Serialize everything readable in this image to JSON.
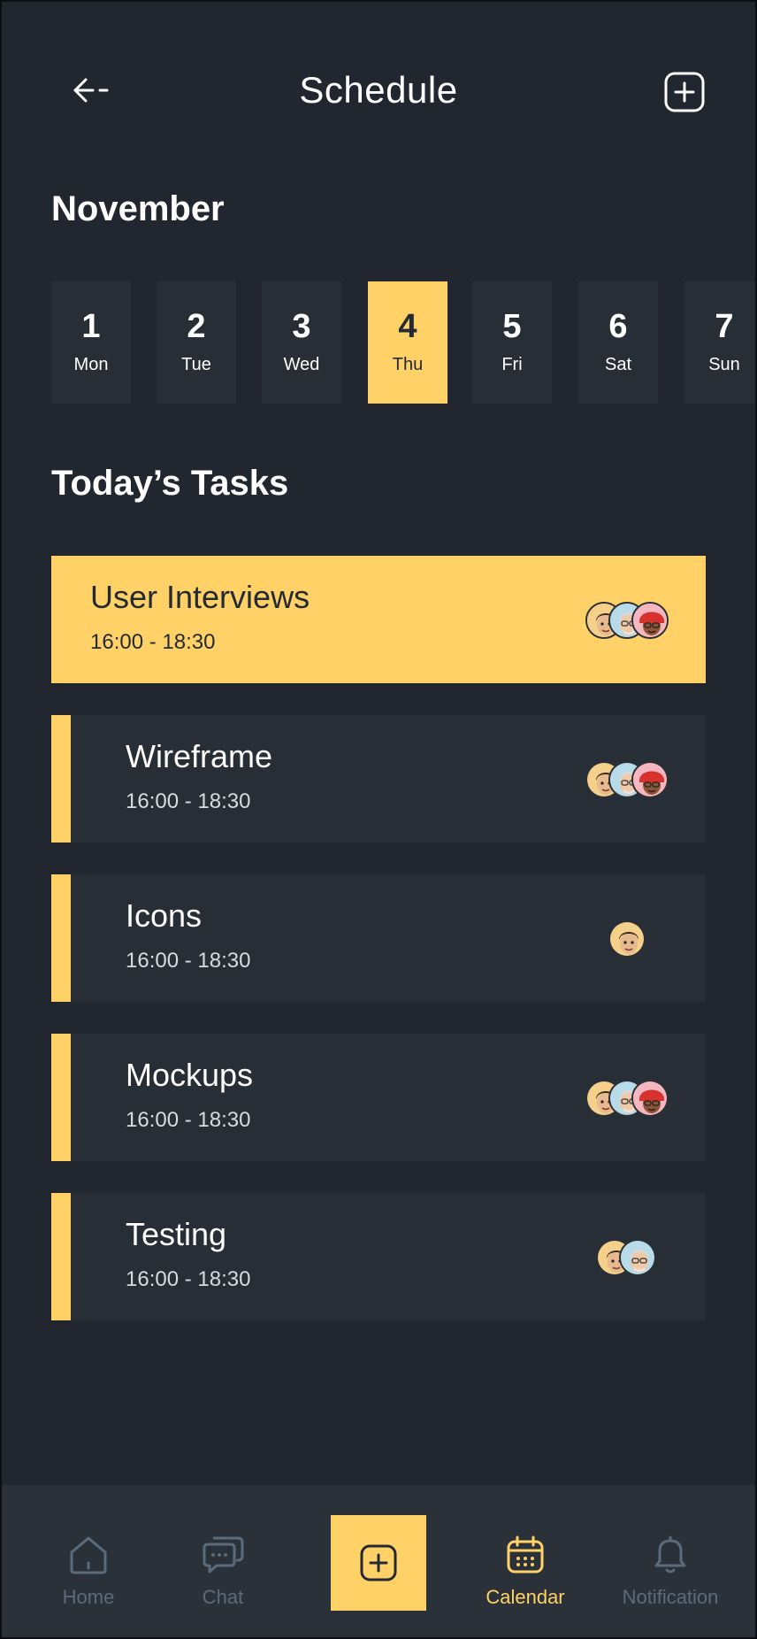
{
  "header": {
    "title": "Schedule"
  },
  "month": "November",
  "days": [
    {
      "num": "1",
      "name": "Mon"
    },
    {
      "num": "2",
      "name": "Tue"
    },
    {
      "num": "3",
      "name": "Wed"
    },
    {
      "num": "4",
      "name": "Thu",
      "selected": true
    },
    {
      "num": "5",
      "name": "Fri"
    },
    {
      "num": "6",
      "name": "Sat"
    },
    {
      "num": "7",
      "name": "Sun"
    }
  ],
  "section_title": "Today’s Tasks",
  "tasks": [
    {
      "name": "User Interviews",
      "time": "16:00 - 18:30",
      "avatars": [
        "avatar-man-dark-hair",
        "avatar-man-gray-hair",
        "avatar-woman-red-hat"
      ],
      "highlighted": true
    },
    {
      "name": "Wireframe",
      "time": "16:00 - 18:30",
      "avatars": [
        "avatar-man-dark-hair",
        "avatar-man-gray-hair",
        "avatar-woman-red-hat"
      ]
    },
    {
      "name": "Icons",
      "time": "16:00 - 18:30",
      "avatars": [
        "avatar-man-dark-hair"
      ]
    },
    {
      "name": "Mockups",
      "time": "16:00 - 18:30",
      "avatars": [
        "avatar-man-dark-hair",
        "avatar-man-gray-hair",
        "avatar-woman-red-hat"
      ]
    },
    {
      "name": "Testing",
      "time": "16:00 - 18:30",
      "avatars": [
        "avatar-man-dark-hair",
        "avatar-man-gray-hair"
      ]
    }
  ],
  "nav": {
    "home": "Home",
    "chat": "Chat",
    "calendar": "Calendar",
    "notification": "Notification"
  },
  "colors": {
    "background": "#22272f",
    "card": "#272e35",
    "accent": "#ffd166",
    "nav_inactive": "#5b6b7b"
  }
}
